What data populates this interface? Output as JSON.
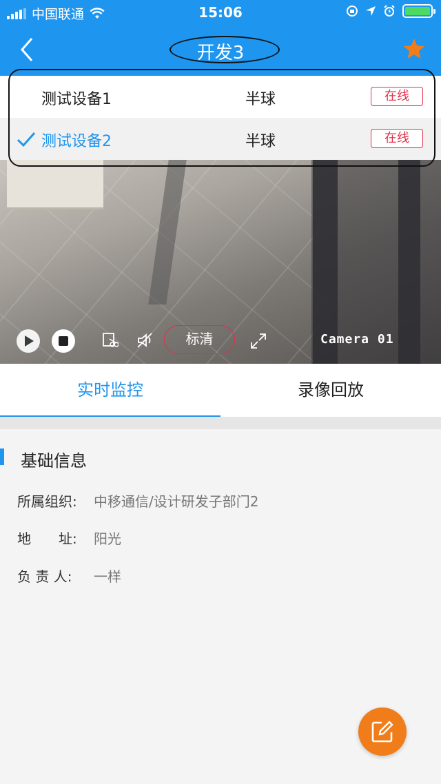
{
  "status_bar": {
    "carrier": "中国联通",
    "time": "15:06",
    "battery_level": 1.0
  },
  "nav": {
    "title": "开发3",
    "back_icon": "chevron-left-icon",
    "favorite_icon": "star-icon"
  },
  "devices": [
    {
      "name": "测试设备1",
      "type": "半球",
      "status": "在线",
      "selected": false
    },
    {
      "name": "测试设备2",
      "type": "半球",
      "status": "在线",
      "selected": true
    }
  ],
  "player": {
    "quality_label": "标清",
    "camera_label": "Camera 01"
  },
  "tabs": [
    {
      "label": "实时监控",
      "active": true
    },
    {
      "label": "录像回放",
      "active": false
    }
  ],
  "info": {
    "section_title": "基础信息",
    "rows": [
      {
        "label": "所属组织:",
        "value": "中移通信/设计研发子部门2"
      },
      {
        "label": "地　　址:",
        "value": "阳光"
      },
      {
        "label": "负 责 人:",
        "value": "一样"
      }
    ]
  },
  "colors": {
    "primary": "#1e95ee",
    "online_red": "#e0304a",
    "fab_orange": "#f07d1a",
    "star_orange": "#f07d1a",
    "battery_green": "#4cd964"
  }
}
